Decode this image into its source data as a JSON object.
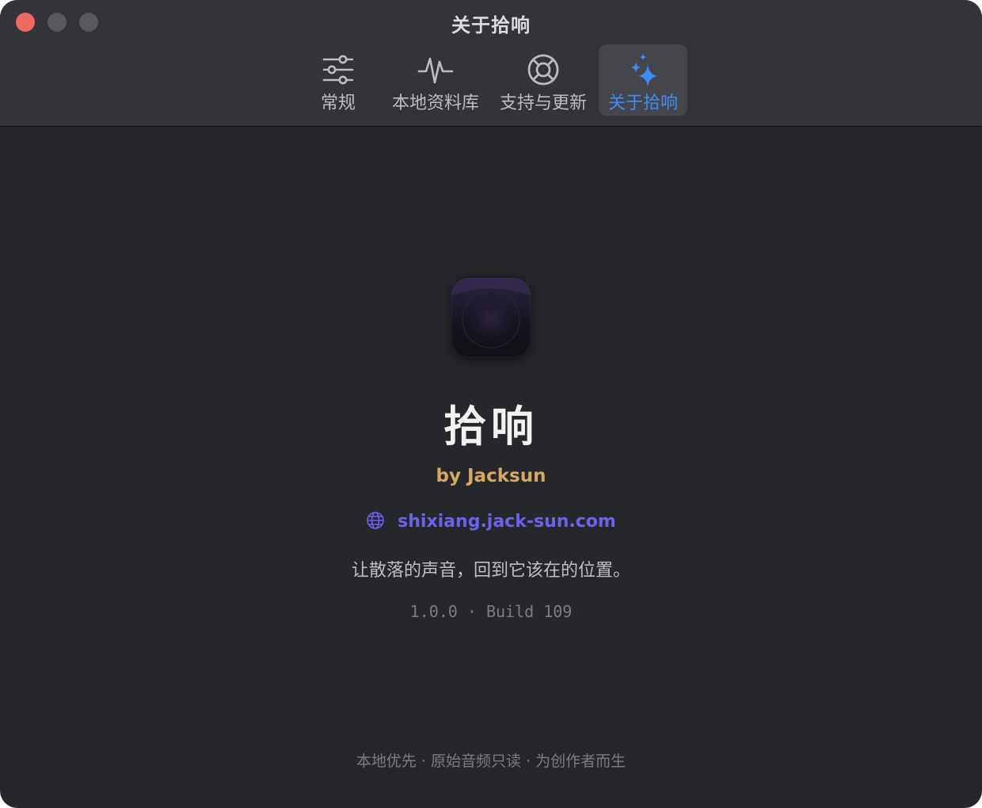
{
  "window": {
    "title": "关于拾响"
  },
  "toolbar": {
    "tabs": [
      {
        "label": "常规",
        "icon": "sliders-icon",
        "active": false
      },
      {
        "label": "本地资料库",
        "icon": "waveform-pulse-icon",
        "active": false
      },
      {
        "label": "支持与更新",
        "icon": "lifebuoy-icon",
        "active": false
      },
      {
        "label": "关于拾响",
        "icon": "sparkles-icon",
        "active": true
      }
    ]
  },
  "about": {
    "app_icon": "app-waveform-logo",
    "app_name": "拾响",
    "byline": "by Jacksun",
    "website": "shixiang.jack-sun.com",
    "tagline": "让散落的声音，回到它该在的位置。",
    "version": "1.0.0 · Build 109",
    "footer": "本地优先 · 原始音频只读 · 为创作者而生"
  },
  "colors": {
    "accent_blue": "#3d8cf5",
    "byline_gold": "#d6a95f",
    "link_purple": "#6c62f0",
    "close_red": "#ee6a5f",
    "window_bg": "#26272b",
    "toolbar_bg": "#333438"
  }
}
